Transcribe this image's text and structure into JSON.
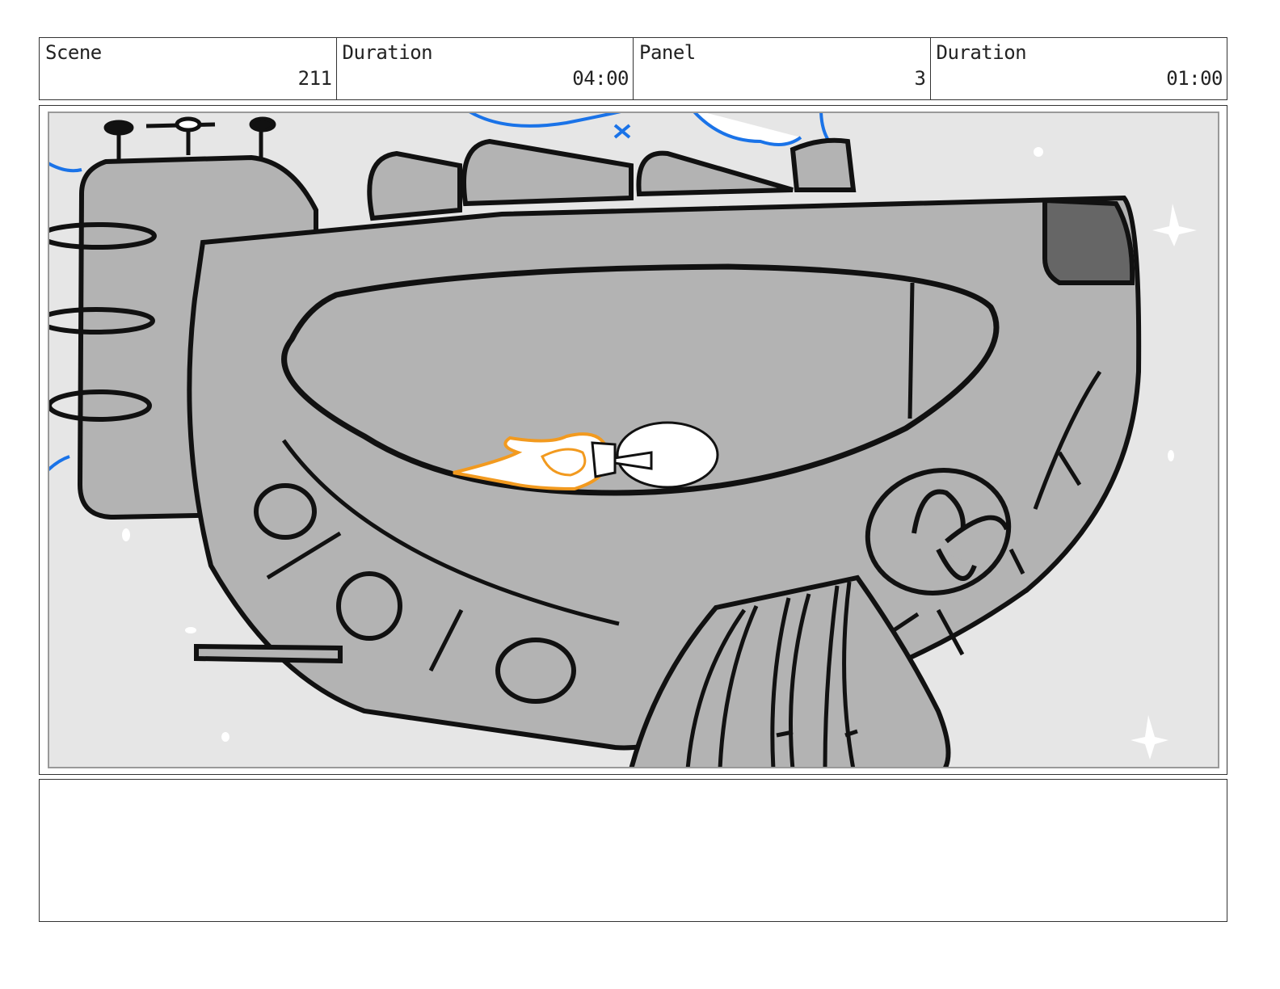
{
  "header": {
    "scene_label": "Scene",
    "scene_value": "211",
    "scene_duration_label": "Duration",
    "scene_duration_value": "04:00",
    "panel_label": "Panel",
    "panel_value": "3",
    "panel_duration_label": "Duration",
    "panel_duration_value": "01:00"
  },
  "artwork": {
    "subject": "spaceship-sketch",
    "colors": {
      "background": "#e6e6e6",
      "hull": "#b3b3b3",
      "hull_dark": "#666666",
      "outline": "#111111",
      "clouds": "#1a73e8",
      "thruster_flame": "#f29a1f"
    }
  },
  "notes": {
    "text": ""
  }
}
